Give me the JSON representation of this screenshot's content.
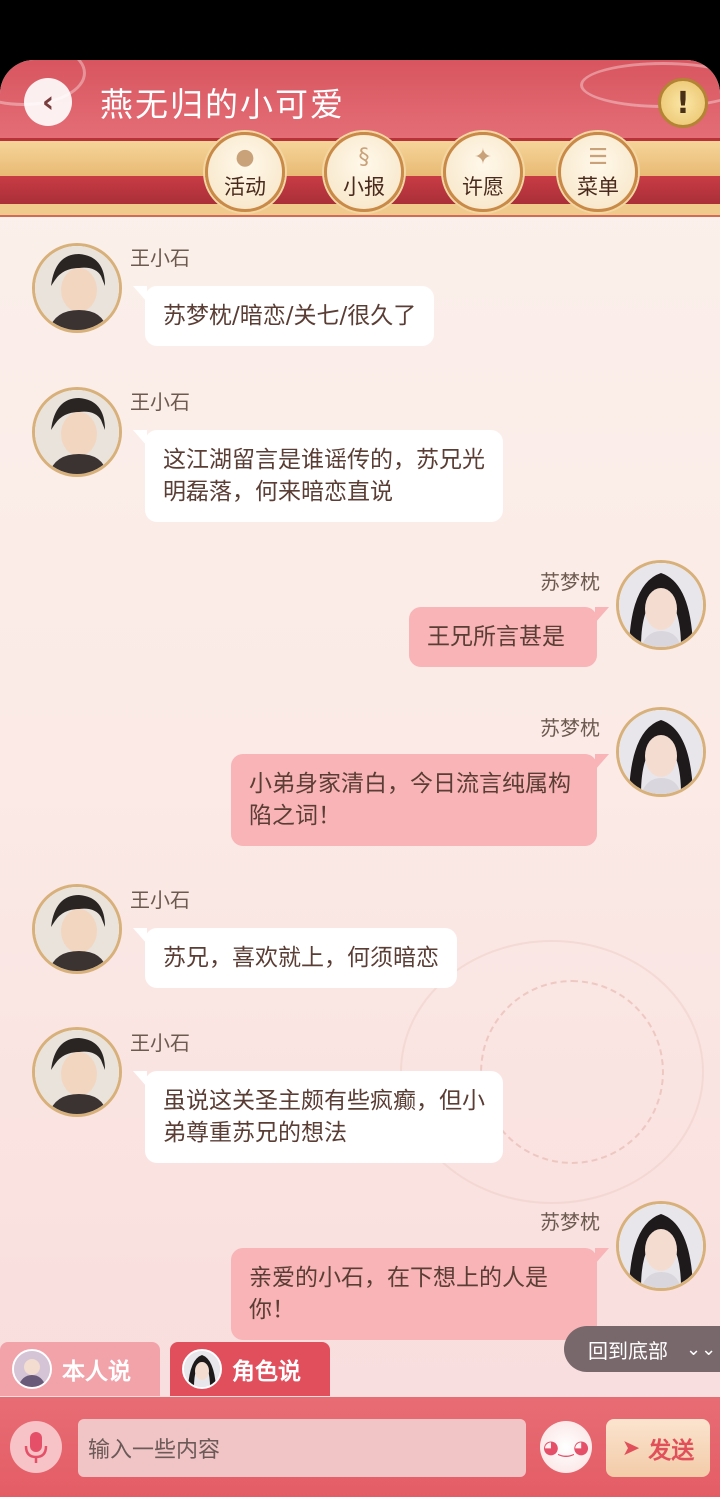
{
  "header": {
    "back_icon": "‹",
    "title": "燕无归的小可爱",
    "alert_icon": "!",
    "nav": [
      {
        "label": "活动",
        "icon": "lantern-icon"
      },
      {
        "label": "小报",
        "icon": "scroll-icon"
      },
      {
        "label": "许愿",
        "icon": "fountain-icon"
      },
      {
        "label": "菜单",
        "icon": "menu-icon"
      }
    ]
  },
  "messages": [
    {
      "side": "left",
      "name": "王小石",
      "text": "苏梦枕/暗恋/关七/很久了"
    },
    {
      "side": "left",
      "name": "王小石",
      "text": "这江湖留言是谁谣传的，苏兄光明磊落，何来暗恋直说"
    },
    {
      "side": "right",
      "name": "苏梦枕",
      "text": "王兄所言甚是"
    },
    {
      "side": "right",
      "name": "苏梦枕",
      "text": "小弟身家清白，今日流言纯属构陷之词！"
    },
    {
      "side": "left",
      "name": "王小石",
      "text": "苏兄，喜欢就上，何须暗恋"
    },
    {
      "side": "left",
      "name": "王小石",
      "text": "虽说这关圣主颇有些疯癫，但小弟尊重苏兄的想法"
    },
    {
      "side": "right",
      "name": "苏梦枕",
      "text": "亲爱的小石，在下想上的人是你！"
    }
  ],
  "scroll_bottom": {
    "label": "回到底部",
    "icon": "chevron-down-icon"
  },
  "tabs": {
    "self_label": "本人说",
    "role_label": "角色说"
  },
  "input": {
    "placeholder": "输入一些内容"
  },
  "send_label": "发送",
  "colors": {
    "accent": "#e14f5c",
    "bubble_right": "#f8b4b7",
    "header": "#d8555f"
  }
}
